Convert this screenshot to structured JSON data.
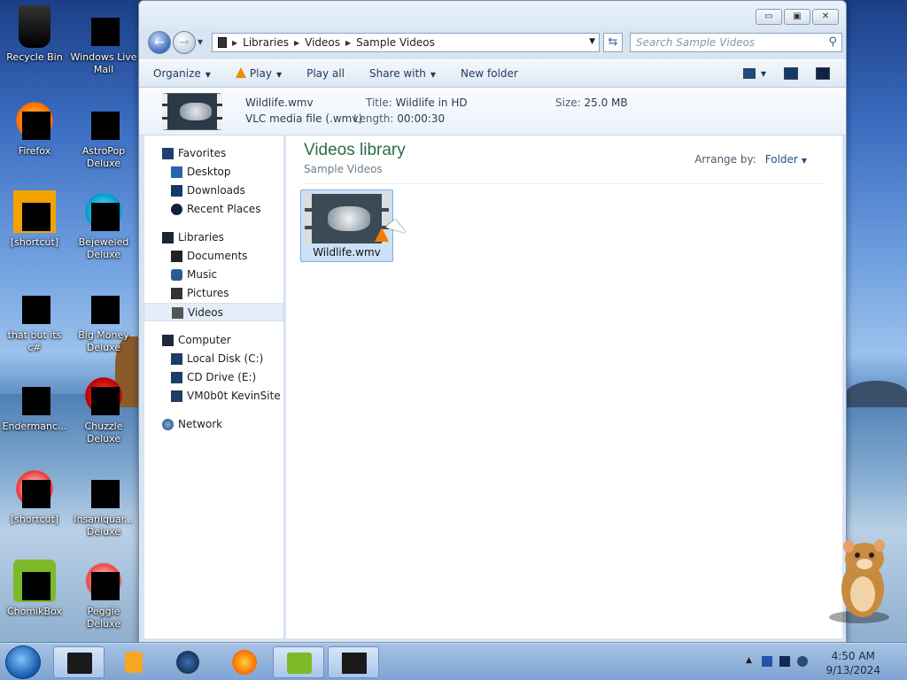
{
  "desktop": {
    "icons": [
      {
        "label": "Recycle Bin"
      },
      {
        "label": "Windows Live Mail"
      },
      {
        "label": "Firefox"
      },
      {
        "label": "AstroPop Deluxe"
      },
      {
        "label": "[shortcut]"
      },
      {
        "label": "Bejeweled Deluxe"
      },
      {
        "label": "that but its c#"
      },
      {
        "label": "Big Money Deluxe"
      },
      {
        "label": "Endermanc..."
      },
      {
        "label": "Chuzzle Deluxe"
      },
      {
        "label": "[shortcut]"
      },
      {
        "label": "Insaniquar... Deluxe"
      },
      {
        "label": "ChomikBox"
      },
      {
        "label": "Peggle Deluxe"
      }
    ]
  },
  "window": {
    "caption_buttons": {
      "minimize": "▭",
      "maximize": "▣",
      "close": "✕"
    },
    "address": {
      "crumbs": [
        "Libraries",
        "Videos",
        "Sample Videos"
      ],
      "search_placeholder": "Search Sample Videos"
    },
    "toolbar": {
      "organize": "Organize",
      "play": "Play",
      "play_all": "Play all",
      "share_with": "Share with",
      "new_folder": "New folder"
    },
    "details": {
      "filename": "Wildlife.wmv",
      "filetype": "VLC media file (.wmv)",
      "title_key": "Title:",
      "title_val": "Wildlife in HD",
      "length_key": "Length:",
      "length_val": "00:00:30",
      "size_key": "Size:",
      "size_val": "25.0 MB"
    },
    "nav": {
      "favorites": "Favorites",
      "desktop": "Desktop",
      "downloads": "Downloads",
      "recent_places": "Recent Places",
      "libraries": "Libraries",
      "documents": "Documents",
      "music": "Music",
      "pictures": "Pictures",
      "videos": "Videos",
      "computer": "Computer",
      "local_disk": "Local Disk (C:)",
      "cd_drive": "CD Drive (E:)",
      "network_drive": "VM0b0t KevinSite",
      "network": "Network"
    },
    "content": {
      "title": "Videos library",
      "subtitle": "Sample Videos",
      "arrange_by": "Arrange by:",
      "arrange_value": "Folder",
      "file_name": "Wildlife.wmv"
    }
  },
  "taskbar": {
    "clock_time": "4:50 AM",
    "clock_date": "9/13/2024",
    "colors": {
      "accent": "#3d6db8",
      "library_title": "#2e6b47"
    }
  }
}
